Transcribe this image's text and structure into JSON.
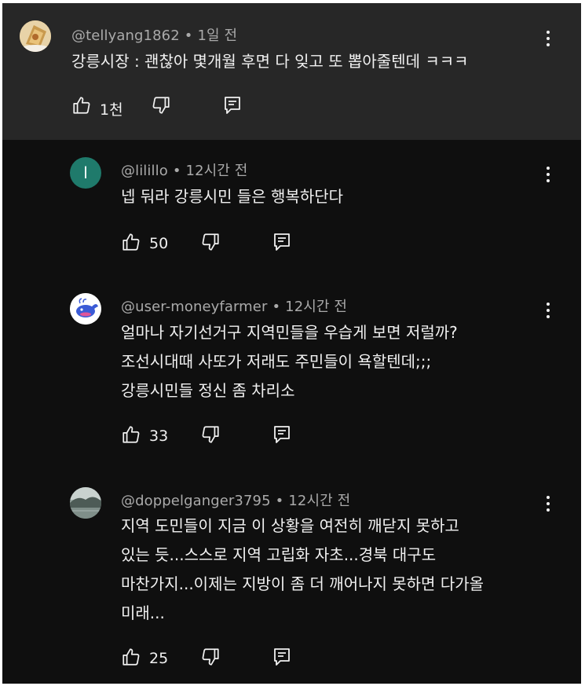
{
  "comments": [
    {
      "handle": "@tellyang1862",
      "time": "1일 전",
      "lines": [
        "강릉시장 : 괜찮아 몇개월 후면 다 잊고 또 뽑아줄텐데 ㅋㅋㅋ"
      ],
      "likes": "1천",
      "avatar_icon": "food-avatar-icon"
    },
    {
      "handle": "@lilillo",
      "time": "12시간 전",
      "lines": [
        "넵 둬라 강릉시민 들은 행복하단다"
      ],
      "likes": "50",
      "avatar_letter": "l",
      "avatar_color": "#1f7a6b"
    },
    {
      "handle": "@user-moneyfarmer",
      "time": "12시간 전",
      "lines": [
        "얼마나 자기선거구 지역민들을 우습게 보면 저럴까?",
        "조선시대때 사또가 저래도 주민들이 욕할텐데;;;",
        "강릉시민들 정신 좀 차리소"
      ],
      "likes": "33",
      "avatar_icon": "whale-avatar-icon"
    },
    {
      "handle": "@doppelganger3795",
      "time": "12시간 전",
      "lines": [
        "지역 도민들이 지금 이 상황을 여전히 깨닫지 못하고",
        "있는 듯...스스로 지역 고립화 자초...경북 대구도",
        "마찬가지...이제는 지방이 좀 더 깨어나지 못하면 다가올",
        "미래..."
      ],
      "likes": "25",
      "avatar_icon": "landscape-avatar-icon"
    }
  ],
  "colors": {
    "top_bg": "#272727",
    "reply_bg": "#0f0f0f",
    "meta": "#aaaaaa",
    "text": "#f1f1f1"
  }
}
